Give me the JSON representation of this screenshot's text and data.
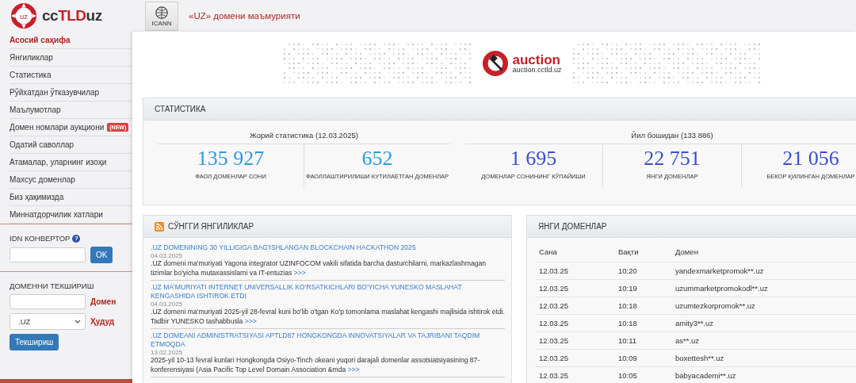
{
  "logo": {
    "emblem_text": "uz",
    "prefix": "cc",
    "highlight": "TLD",
    "suffix": "uz"
  },
  "header": {
    "icann_label": "ICANN",
    "title": "«UZ» домени маъмурияти"
  },
  "nav": [
    {
      "label": "Асосий саҳифа",
      "selected": true
    },
    {
      "label": "Янгиликлар",
      "selected": false
    },
    {
      "label": "Статистика",
      "selected": false
    },
    {
      "label": "Рўйхатдан ўтказувчилар",
      "selected": false
    },
    {
      "label": "Маълумотлар",
      "selected": false
    },
    {
      "label": "Домен номлари аукциони",
      "selected": false,
      "badge": "(NEW)"
    },
    {
      "label": "Одатий саволлар",
      "selected": false
    },
    {
      "label": "Атамалар, уларнинг изоҳи",
      "selected": false
    },
    {
      "label": "Махсус доменлар",
      "selected": false
    },
    {
      "label": "Биз ҳақимизда",
      "selected": false
    },
    {
      "label": "Миннатдорчилик хатлари",
      "selected": false
    }
  ],
  "idn_converter": {
    "title": "IDN КОНВЕРТОР",
    "help": "?",
    "button": "OK"
  },
  "domain_check": {
    "title": "ДОМЕННИ ТЕКШИРИШ",
    "domain_label": "Домен",
    "zone_value": ".UZ",
    "zone_label": "Ҳудуд",
    "button": "Текшириш"
  },
  "banner": {
    "title": "auction",
    "url": "auction.cctld.uz"
  },
  "statistics": {
    "title": "СТАТИСТИКА",
    "groups": [
      {
        "caption": "Жорий статистика (12.03.2025)",
        "color": "#2e9bd6",
        "items": [
          {
            "value": "135 927",
            "label": "ФАОЛ ДОМЕНЛАР СОНИ"
          },
          {
            "value": "652",
            "label": "ФАОЛЛАШТИРИЛИШИ КУТИЛАЁТГАН ДОМЕНЛАР"
          }
        ]
      },
      {
        "caption": "Йил бошидан (133 886)",
        "color": "#3a4fc8",
        "items": [
          {
            "value": "1 695",
            "label": "ДОМЕНЛАР СОНИНИНГ КЎПАЙИШИ"
          },
          {
            "value": "22 751",
            "label": "ЯНГИ ДОМЕНЛАР"
          },
          {
            "value": "21 056",
            "label": "БЕКОР ҚИЛИНГАН ДОМЕНЛАР"
          }
        ]
      }
    ]
  },
  "news": {
    "title": "СЎНГГИ ЯНГИЛИКЛАР",
    "items": [
      {
        "title": ".UZ DOMENINING 30 YILLIGIGA BAG'ISHLANGAN BLOCKCHAIN HACKATHON 2025",
        "date": "04.03.2025",
        "text": ".UZ domeni ma'muriyati Yagona integrator UZINFOCOM vakili sifatida barcha dasturchilarni, markazlashmagan tizimlar bo'yicha mutaxassislarni va IT-entuzias",
        "more": ">>>"
      },
      {
        "title": ".UZ MA'MURIYATI INTERNET UNIVERSALLIK KO'RSATKICHLARI BO'YICHA YUNESKO MASLAHAT KENGASHIDA ISHTIROK ETDI",
        "date": "04.03.2025",
        "text": ".UZ domeni ma'muriyati 2025-yil 28-fevral kuni bo'lib o'tgan Ko'p tomonlama maslahat kengashi majlisida ishtirok etdi. Tadbir YUNESKO tashabbusla",
        "more": ">>>"
      },
      {
        "title": ".UZ DOMEANI ADMINISTRATSIYASI APTLD87 HONGKONGDA INNOVATSIYALAR VA TAJRIBANI TAQDIM ETMOQDA",
        "date": "13.02.2025",
        "text": "2025-yil 10-13 fevral kunlari Hongkongda Osiyo-Tinch okeani yuqori darajali domenlar assotsiatsiyasining 87-konferensiyasi (Asia Pacific Top Level Domain Association &mda",
        "more": ">>>"
      }
    ]
  },
  "new_domains": {
    "title": "ЯНГИ ДОМЕНЛАР",
    "columns": [
      "Сана",
      "Вақти",
      "Домен"
    ],
    "rows": [
      [
        "12.03.25",
        "10:20",
        "yandexmarketpromok**.uz"
      ],
      [
        "12.03.25",
        "10:19",
        "uzummarketpromokodl**.uz"
      ],
      [
        "12.03.25",
        "10:18",
        "uzumtezkorpromok**.uz"
      ],
      [
        "12.03.25",
        "10:18",
        "amity3**.uz"
      ],
      [
        "12.03.25",
        "10:11",
        "as**.uz"
      ],
      [
        "12.03.25",
        "10:09",
        "boxettesh**.uz"
      ],
      [
        "12.03.25",
        "10:05",
        "babyacademi**.uz"
      ]
    ]
  }
}
